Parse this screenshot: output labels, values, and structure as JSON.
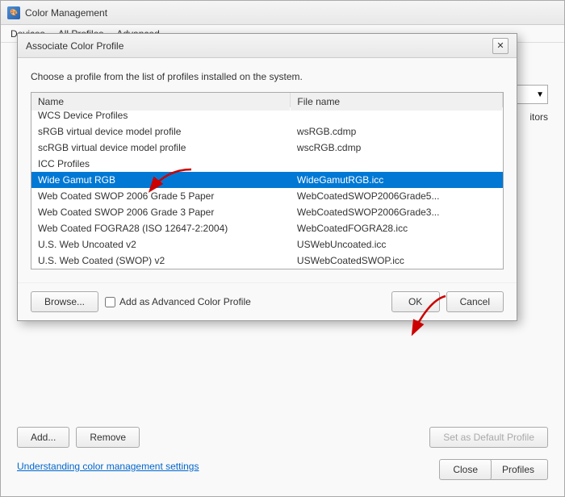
{
  "mainWindow": {
    "title": "Color Management",
    "menuItems": [
      "Devices",
      "All Profiles",
      "Advanced"
    ]
  },
  "backgroundContent": {
    "monitorsLabel": "itors",
    "addButton": "Add...",
    "removeButton": "Remove",
    "setDefaultButton": "Set as Default Profile",
    "linkText": "Understanding color management settings",
    "profilesButton": "Profiles",
    "closeButton": "Close"
  },
  "dialog": {
    "title": "Associate Color Profile",
    "closeButton": "✕",
    "description": "Choose a profile from the list of profiles installed on the system.",
    "tableHeaders": [
      "Name",
      "File name"
    ],
    "profileRows": [
      {
        "type": "category",
        "name": "WCS Device Profiles",
        "filename": ""
      },
      {
        "type": "profile",
        "name": "sRGB virtual device model profile",
        "filename": "wsRGB.cdmp"
      },
      {
        "type": "profile",
        "name": "scRGB virtual device model profile",
        "filename": "wscRGB.cdmp"
      },
      {
        "type": "category",
        "name": "ICC Profiles",
        "filename": ""
      },
      {
        "type": "profile",
        "name": "Wide Gamut RGB",
        "filename": "WideGamutRGB.icc",
        "selected": true
      },
      {
        "type": "profile",
        "name": "Web Coated SWOP 2006 Grade 5 Paper",
        "filename": "WebCoatedSWOP2006Grade5..."
      },
      {
        "type": "profile",
        "name": "Web Coated SWOP 2006 Grade 3 Paper",
        "filename": "WebCoatedSWOP2006Grade3..."
      },
      {
        "type": "profile",
        "name": "Web Coated FOGRA28 (ISO 12647-2:2004)",
        "filename": "WebCoatedFOGRA28.icc"
      },
      {
        "type": "profile",
        "name": "U.S. Web Uncoated v2",
        "filename": "USWebUncoated.icc"
      },
      {
        "type": "profile",
        "name": "U.S. Web Coated (SWOP) v2",
        "filename": "USWebCoatedSWOP.icc"
      }
    ],
    "browseButton": "Browse...",
    "checkboxLabel": "Add as Advanced Color Profile",
    "okButton": "OK",
    "cancelButton": "Cancel"
  }
}
